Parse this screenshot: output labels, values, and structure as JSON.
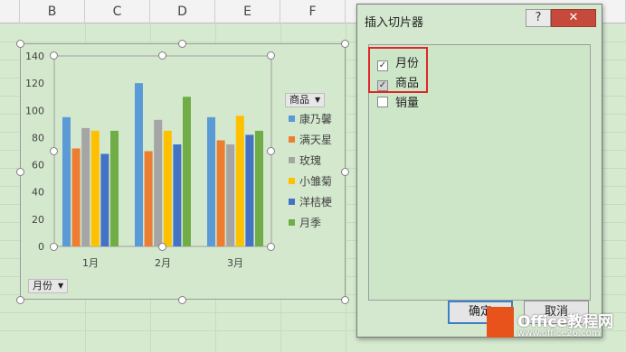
{
  "sheet": {
    "columns": [
      "B",
      "C",
      "D",
      "E",
      "F"
    ]
  },
  "chart_data": {
    "type": "bar",
    "categories": [
      "1月",
      "2月",
      "3月"
    ],
    "series": [
      {
        "name": "康乃馨",
        "color": "#5b9bd5",
        "values": [
          95,
          120,
          95
        ]
      },
      {
        "name": "满天星",
        "color": "#ed7d31",
        "values": [
          72,
          70,
          78
        ]
      },
      {
        "name": "玫瑰",
        "color": "#a5a5a5",
        "values": [
          87,
          93,
          75
        ]
      },
      {
        "name": "小雏菊",
        "color": "#ffc000",
        "values": [
          85,
          85,
          96
        ]
      },
      {
        "name": "洋桔梗",
        "color": "#4472c4",
        "values": [
          68,
          75,
          82
        ]
      },
      {
        "name": "月季",
        "color": "#70ad47",
        "values": [
          85,
          110,
          85
        ]
      }
    ],
    "yticks": [
      "140",
      "120",
      "100",
      "80",
      "60",
      "40",
      "20",
      "0"
    ],
    "ylim": [
      0,
      140
    ],
    "grid": false,
    "legend_position": "right",
    "legend_field_label": "商品",
    "axis_field_label": "月份"
  },
  "dialog": {
    "title": "插入切片器",
    "help_label": "?",
    "close_label": "✕",
    "options": [
      {
        "label": "月份",
        "checked": true,
        "mark": "✓"
      },
      {
        "label": "商品",
        "checked": true,
        "mark": "✓"
      },
      {
        "label": "销量",
        "checked": false,
        "mark": ""
      }
    ],
    "ok_label": "确定",
    "cancel_label": "取消"
  },
  "watermark": {
    "title": "Office教程网",
    "url": "www.office26.com"
  }
}
